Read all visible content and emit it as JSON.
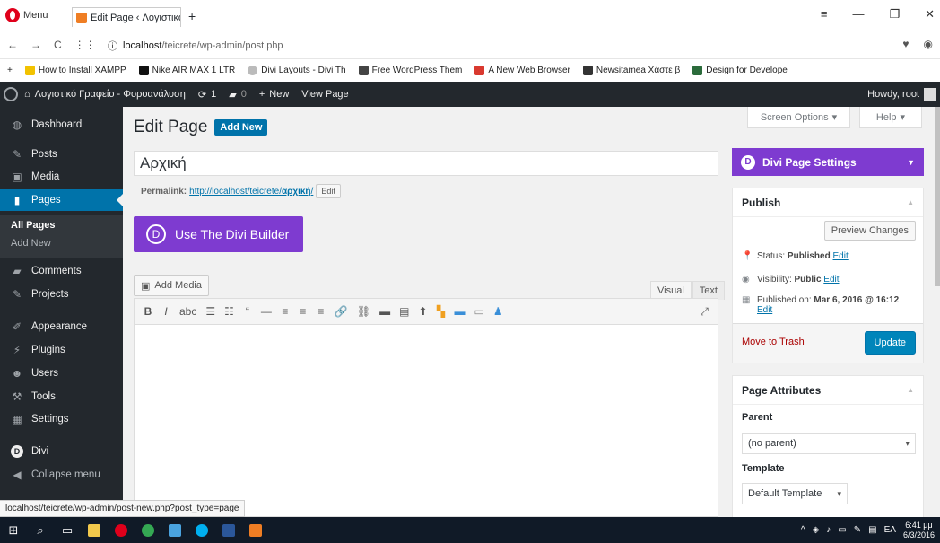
{
  "browser": {
    "menu_label": "Menu",
    "tab_title": "Edit Page ‹ Λογιστικό Γραφ",
    "tab_close": "×",
    "new_tab": "+",
    "url_host": "localhost",
    "url_path": "/teicrete/wp-admin/post.php",
    "bookmarks": [
      {
        "label": "How to Install XAMPP",
        "color": "#f2c200"
      },
      {
        "label": "Nike AIR MAX 1 LTR",
        "color": "#111111"
      },
      {
        "label": "Divi Layouts - Divi Th",
        "color": "#bbbbbb"
      },
      {
        "label": "Free WordPress Them",
        "color": "#444444"
      },
      {
        "label": "A New Web Browser",
        "color": "#d9392f"
      },
      {
        "label": "Newsitamea Χάστε β",
        "color": "#333333"
      },
      {
        "label": "Design for Develope",
        "color": "#2b6b3b"
      }
    ]
  },
  "adminbar": {
    "site_name": "Λογιστικό Γραφείο - Φοροανάλυση",
    "updates_count": "1",
    "comments_count": "0",
    "new_label": "New",
    "view_page": "View Page",
    "howdy": "Howdy, root"
  },
  "menu": {
    "items": [
      {
        "label": "Dashboard",
        "icon": "dashboard-icon"
      },
      {
        "label": "Posts",
        "icon": "pin-icon"
      },
      {
        "label": "Media",
        "icon": "media-icon"
      },
      {
        "label": "Pages",
        "icon": "page-icon"
      },
      {
        "label": "Comments",
        "icon": "comment-icon"
      },
      {
        "label": "Projects",
        "icon": "pin-icon"
      },
      {
        "label": "Appearance",
        "icon": "brush-icon"
      },
      {
        "label": "Plugins",
        "icon": "plug-icon"
      },
      {
        "label": "Users",
        "icon": "users-icon"
      },
      {
        "label": "Tools",
        "icon": "wrench-icon"
      },
      {
        "label": "Settings",
        "icon": "settings-icon"
      },
      {
        "label": "Divi",
        "icon": "divi-icon"
      },
      {
        "label": "Collapse menu",
        "icon": "collapse-icon"
      }
    ],
    "sub_all_pages": "All Pages",
    "sub_add_new": "Add New"
  },
  "screen_options": "Screen Options",
  "help": "Help",
  "page": {
    "heading": "Edit Page",
    "add_new": "Add New",
    "title_value": "Αρχική",
    "permalink_label": "Permalink:",
    "permalink_base": "http://localhost/teicrete/",
    "permalink_slug": "αρχική",
    "permalink_end": "/",
    "edit_button": "Edit",
    "divi_button": "Use The Divi Builder",
    "add_media": "Add Media",
    "visual_tab": "Visual",
    "text_tab": "Text"
  },
  "sidebar": {
    "divi_settings": "Divi Page Settings",
    "publish": {
      "title": "Publish",
      "preview": "Preview Changes",
      "status_label": "Status:",
      "status_value": "Published",
      "visibility_label": "Visibility:",
      "visibility_value": "Public",
      "published_label": "Published on:",
      "published_value": "Mar 6, 2016 @ 16:12",
      "edit": "Edit",
      "trash": "Move to Trash",
      "update": "Update"
    },
    "attributes": {
      "title": "Page Attributes",
      "parent_label": "Parent",
      "parent_value": "(no parent)",
      "template_label": "Template",
      "template_value": "Default Template"
    }
  },
  "status_url": "localhost/teicrete/wp-admin/post-new.php?post_type=page",
  "taskbar": {
    "lang": "ΕΛ",
    "time": "6:41 μμ",
    "date": "6/3/2016"
  },
  "colors": {
    "accent": "#0073aa",
    "divi_purple": "#7e3bd0",
    "adminbar": "#23282d"
  }
}
